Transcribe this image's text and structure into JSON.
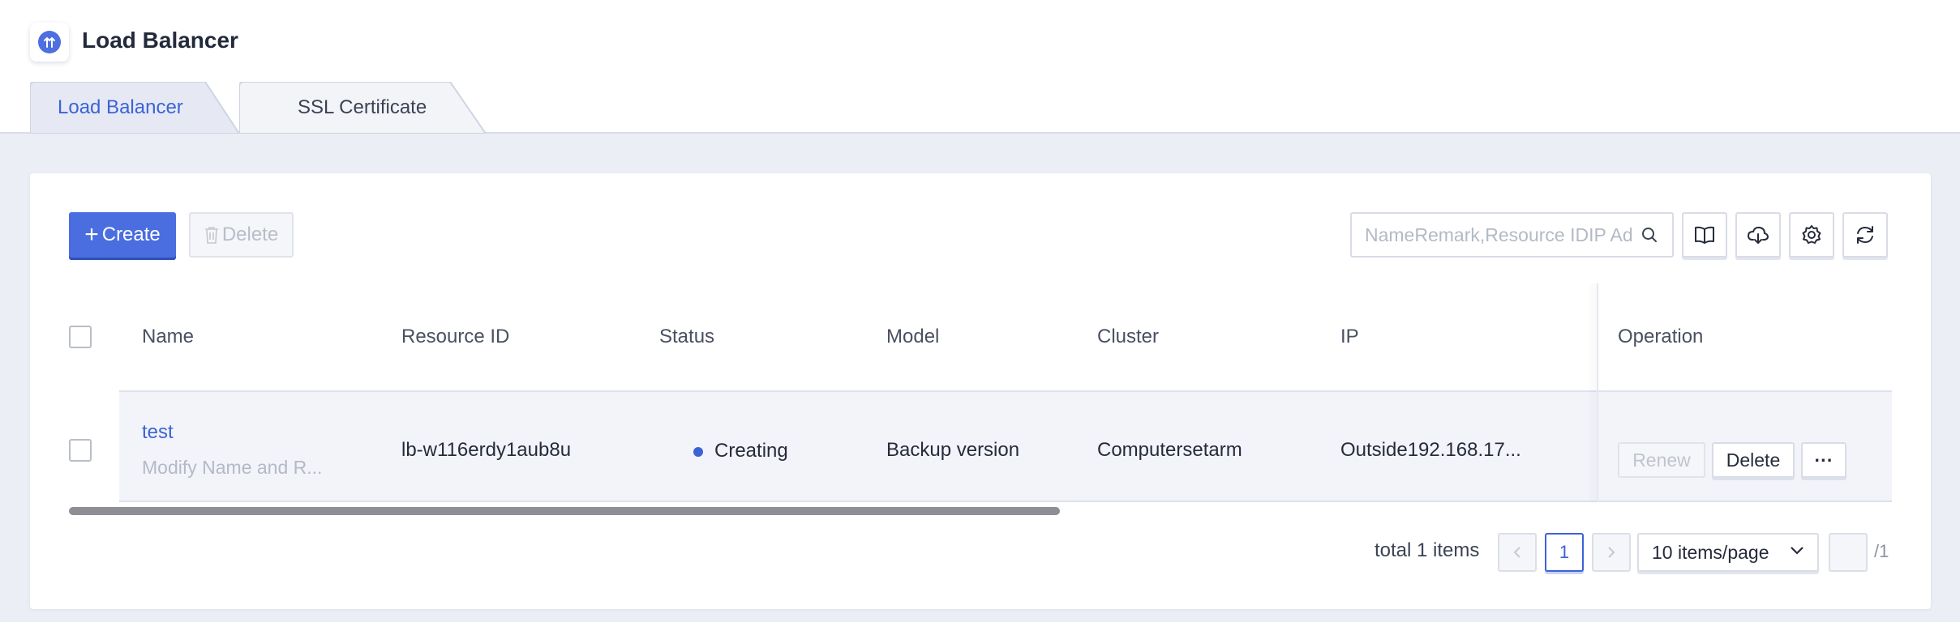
{
  "header": {
    "title": "Load Balancer",
    "logo_icon": "load-balancer-icon"
  },
  "tabs": [
    {
      "label": "Load Balancer",
      "active": true
    },
    {
      "label": "SSL Certificate",
      "active": false
    }
  ],
  "toolbar": {
    "create_label": "Create",
    "delete_label": "Delete",
    "search_placeholder": "NameRemark,Resource IDIP Address",
    "tools": [
      "book-icon",
      "cloud-download-icon",
      "gear-icon",
      "refresh-icon"
    ]
  },
  "table": {
    "columns": [
      "Name",
      "Resource ID",
      "Status",
      "Model",
      "Cluster",
      "IP",
      "Operation"
    ],
    "rows": [
      {
        "name": "test",
        "remark": "Modify Name and R...",
        "resource_id": "lb-w116erdy1aub8u",
        "status": "Creating",
        "model": "Backup version",
        "cluster": "Computersetarm",
        "ip": "Outside192.168.17...",
        "ops": {
          "renew": "Renew",
          "delete": "Delete",
          "more": "···"
        }
      }
    ]
  },
  "pagination": {
    "total_text": "total 1 items",
    "current_page": "1",
    "page_size": "10 items/page",
    "total_pages": "/1"
  },
  "colors": {
    "accent": "#4a6ee0",
    "status_creating": "#3b63d6",
    "page_bg": "#eceef5"
  }
}
